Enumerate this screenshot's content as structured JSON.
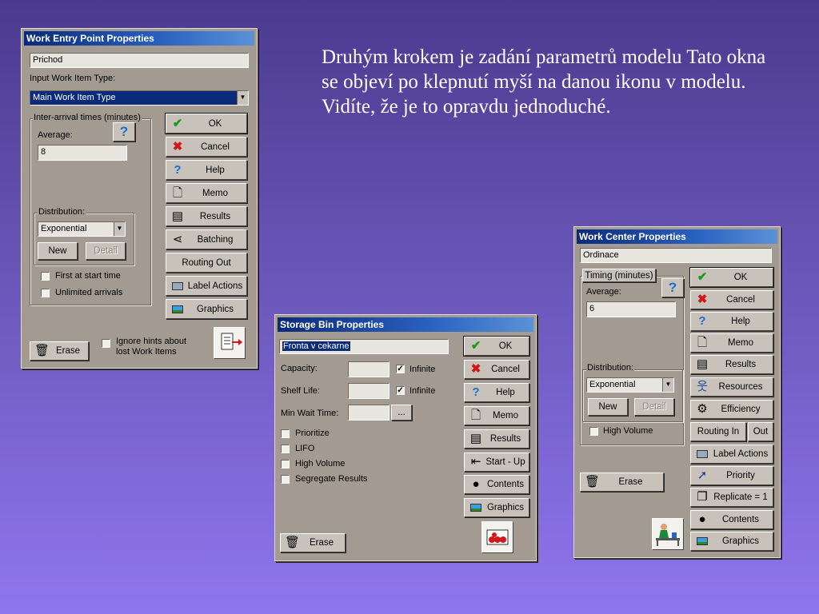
{
  "caption": "Druhým krokem je zadání parametrů modelu Tato okna se objeví po klepnutí myší na danou ikonu v modelu. Vidíte, že je to opravdu jednoduché.",
  "colors": {
    "titlebar": "#0a2a7a",
    "window_bg": "#a39a91",
    "ok_check": "#1c9a1c",
    "cancel_x": "#d01818",
    "help_q": "#1a6fd0"
  },
  "wep": {
    "title": "Work Entry Point Properties",
    "name_value": "Prichod",
    "item_type_label": "Input Work Item Type:",
    "item_type_value": "Main Work Item Type",
    "group_label": "Inter-arrival times (minutes)",
    "average_label": "Average:",
    "average_value": "8",
    "distribution_label": "Distribution:",
    "distribution_value": "Exponential",
    "new_label": "New",
    "detail_label": "Detail",
    "first_at_start": "First at start time",
    "unlimited_arrivals": "Unlimited arrivals",
    "ignore_hints": "Ignore hints about lost Work Items",
    "erase_label": "Erase",
    "buttons": {
      "ok": "OK",
      "cancel": "Cancel",
      "help": "Help",
      "memo": "Memo",
      "results": "Results",
      "batching": "Batching",
      "routing_out": "Routing Out",
      "label_actions": "Label Actions",
      "graphics": "Graphics"
    }
  },
  "sbp": {
    "title": "Storage Bin Properties",
    "name_value": "Fronta v cekarne",
    "capacity_label": "Capacity:",
    "shelf_life_label": "Shelf Life:",
    "min_wait_label": "Min Wait Time:",
    "infinite_label": "Infinite",
    "ellipsis": "...",
    "prioritize": "Prioritize",
    "lifo": "LIFO",
    "high_volume": "High Volume",
    "segregate": "Segregate Results",
    "erase_label": "Erase",
    "buttons": {
      "ok": "OK",
      "cancel": "Cancel",
      "help": "Help",
      "memo": "Memo",
      "results": "Results",
      "start_up": "Start - Up",
      "contents": "Contents",
      "graphics": "Graphics"
    }
  },
  "wcp": {
    "title": "Work Center Properties",
    "name_value": "Ordinace",
    "group_label": "Timing (minutes)",
    "average_label": "Average:",
    "average_value": "6",
    "distribution_label": "Distribution:",
    "distribution_value": "Exponential",
    "new_label": "New",
    "detail_label": "Detail",
    "high_volume": "High Volume",
    "erase_label": "Erase",
    "buttons": {
      "ok": "OK",
      "cancel": "Cancel",
      "help": "Help",
      "memo": "Memo",
      "results": "Results",
      "resources": "Resources",
      "efficiency": "Efficiency",
      "routing_in": "Routing In",
      "out": "Out",
      "label_actions": "Label Actions",
      "priority": "Priority",
      "replicate": "Replicate = 1",
      "contents": "Contents",
      "graphics": "Graphics"
    }
  }
}
